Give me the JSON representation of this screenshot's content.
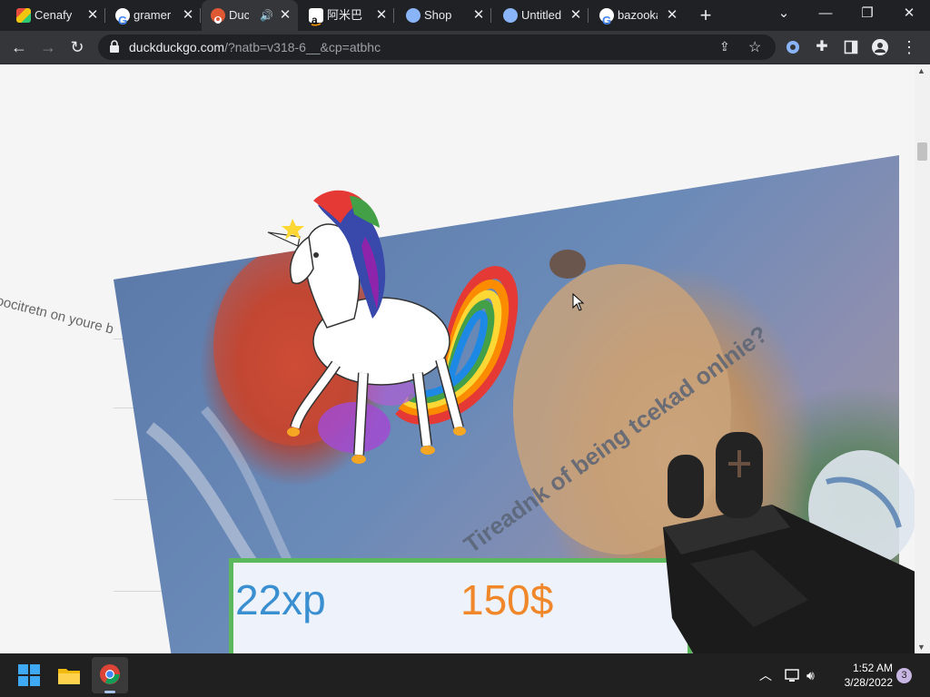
{
  "tabs": [
    {
      "title": "Cenafy",
      "favicon": "cenafy-icon"
    },
    {
      "title": "gramer",
      "favicon": "google-icon"
    },
    {
      "title": "Duc",
      "favicon": "duckduckgo-icon",
      "active": true,
      "audio": true
    },
    {
      "title": "阿米巴",
      "favicon": "amazon-icon"
    },
    {
      "title": "Shop",
      "favicon": "globe-icon"
    },
    {
      "title": "Untitled",
      "favicon": "globe-icon"
    },
    {
      "title": "bazooka",
      "favicon": "google-icon"
    }
  ],
  "address_bar": {
    "host": "duckduckgo.com",
    "path": "/?natb=v318-6__&cp=atbhc"
  },
  "page": {
    "rotated_text": "poocitretn on youre b",
    "meme_caption": "Tireadnk of being tcekad onlnie?",
    "xp": "22xp",
    "money": "150$"
  },
  "taskbar": {
    "time": "1:52 AM",
    "date": "3/28/2022",
    "notification_count": "3"
  },
  "colors": {
    "tabstrip": "#202124",
    "toolbar": "#35363a",
    "xp_text": "#3a8fd1",
    "money_text": "#f0882b",
    "stats_border": "#5cb85c"
  }
}
